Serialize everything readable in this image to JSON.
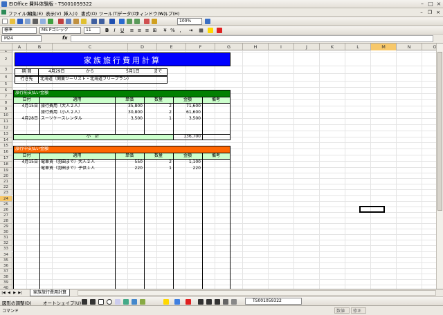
{
  "window": {
    "title": "EIOffice 費料体験版 - TS001059322"
  },
  "menu": [
    "ファイル(F)",
    "編集(E)",
    "表示(V)",
    "挿入(I)",
    "書式(O)",
    "ツール(T)",
    "データ(D)",
    "ウィンドウ(W)",
    "ヘルプ(H)"
  ],
  "toolbar": {
    "zoom": "100%",
    "style": "標準",
    "font": "MS Pゴシック",
    "size": "11"
  },
  "formula_bar": {
    "name_box": "M24",
    "fx": "fx",
    "value": ""
  },
  "columns": [
    "A",
    "B",
    "C",
    "D",
    "E",
    "F",
    "G",
    "H",
    "I",
    "J",
    "K",
    "L",
    "M",
    "N",
    "O"
  ],
  "rows": [
    "1",
    "2",
    "3",
    "4",
    "5",
    "6",
    "7",
    "8",
    "9",
    "10",
    "11",
    "12",
    "13",
    "14",
    "15",
    "16",
    "17",
    "18",
    "19",
    "20",
    "21",
    "22",
    "23",
    "24",
    "25",
    "26",
    "27",
    "28",
    "29",
    "30",
    "31",
    "32",
    "33",
    "34",
    "35",
    "36",
    "37",
    "38",
    "39",
    "40",
    "41"
  ],
  "sheet": {
    "title": "家族旅行費用計算",
    "period_label": "期 間",
    "date_from": "4月29日",
    "from": "から",
    "date_to": "5月1日",
    "to": "まで",
    "destination_label": "行き先",
    "destination": "北海道（関東ツーリスト・北海道フリープラン）",
    "pre_section": {
      "title": "旅行前支払い金額",
      "headers": [
        "日付",
        "適用",
        "単価",
        "数量",
        "金額",
        "備考"
      ],
      "rows": [
        {
          "date": "4月15日",
          "desc": "旅行費用（大人２人）",
          "price": "35,800",
          "qty": "2",
          "amount": "71,600"
        },
        {
          "date": "",
          "desc": "旅行費用（小人２人）",
          "price": "30,800",
          "qty": "2",
          "amount": "61,600"
        },
        {
          "date": "4月28日",
          "desc": "スーツケースレンタル",
          "price": "3,500",
          "qty": "1",
          "amount": "3,500"
        }
      ],
      "subtotal_label": "小 計",
      "subtotal": "136,700"
    },
    "during_section": {
      "title": "旅行中支払い金額",
      "headers": [
        "日付",
        "適用",
        "単価",
        "数量",
        "金額",
        "備考"
      ],
      "rows": [
        {
          "date": "4月15日",
          "desc": "電車賃（羽田まで）大人２人",
          "price": "550",
          "qty": "2",
          "amount": "1,100"
        },
        {
          "date": "",
          "desc": "電車賃（羽田まで）子供１人",
          "price": "220",
          "qty": "1",
          "amount": "220"
        }
      ]
    }
  },
  "tabs": {
    "sheet": "家族旅行費用計算"
  },
  "drawbar": {
    "draw": "図形の調整(D)",
    "autoshape": "オートシェイプ(U)",
    "task": "TS001059322"
  },
  "status": {
    "left": "コマンド",
    "caps": "数値",
    "scroll": "修正"
  },
  "colors": {
    "title_bg": "#0000ff",
    "pre_header": "#008000",
    "during_header": "#ff6600",
    "subtotal_bg": "#ccffcc",
    "table_head": "#ccffcc"
  }
}
